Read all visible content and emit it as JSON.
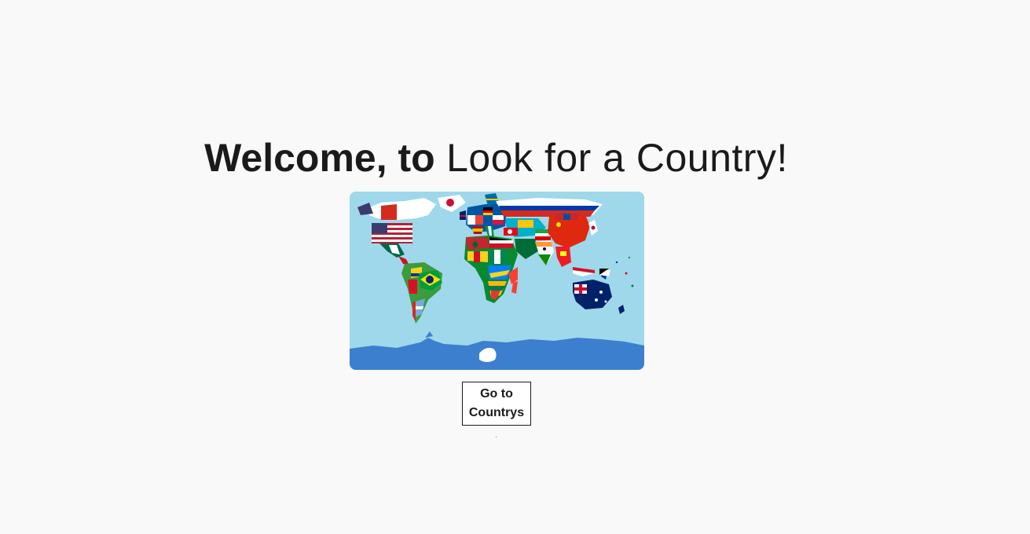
{
  "hero": {
    "title_strong": "Welcome, to",
    "title_rest": "Look for a Country!",
    "map_image": "world-flag-map"
  },
  "actions": {
    "go_button_label": "Go to Countrys"
  },
  "colors": {
    "background": "#f9f9f9",
    "ocean": "#9ed8ea",
    "antarctica_water": "#3c7fcf",
    "text": "#1a1a1a"
  }
}
